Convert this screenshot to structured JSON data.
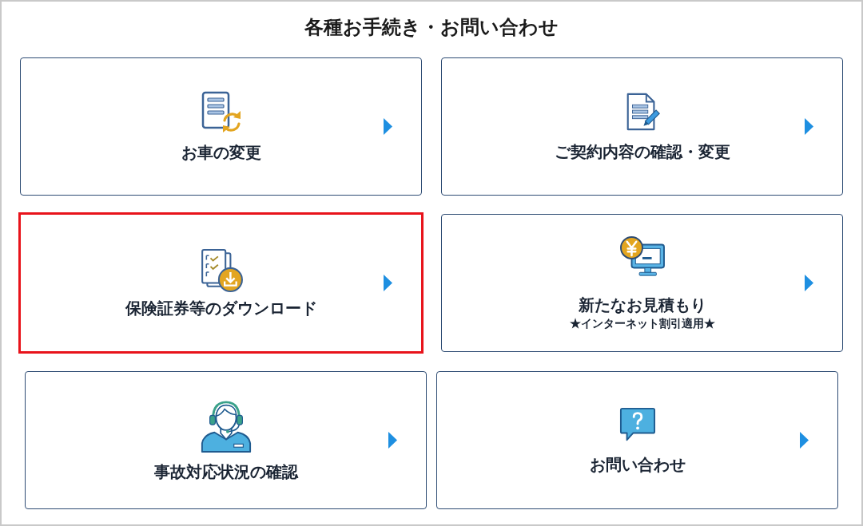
{
  "title": "各種お手続き・お問い合わせ",
  "cards": [
    {
      "kind": "sync",
      "label": "お車の変更",
      "highlighted": false
    },
    {
      "kind": "edit",
      "label": "ご契約内容の確認・変更",
      "highlighted": false
    },
    {
      "kind": "download",
      "label": "保険証券等のダウンロード",
      "highlighted": true
    },
    {
      "kind": "quote",
      "label": "新たなお見積もり",
      "note": "★インターネット割引適用★",
      "highlighted": false
    },
    {
      "kind": "operator",
      "label": "事故対応状況の確認",
      "highlighted": false
    },
    {
      "kind": "help",
      "label": "お問い合わせ",
      "highlighted": false
    }
  ]
}
